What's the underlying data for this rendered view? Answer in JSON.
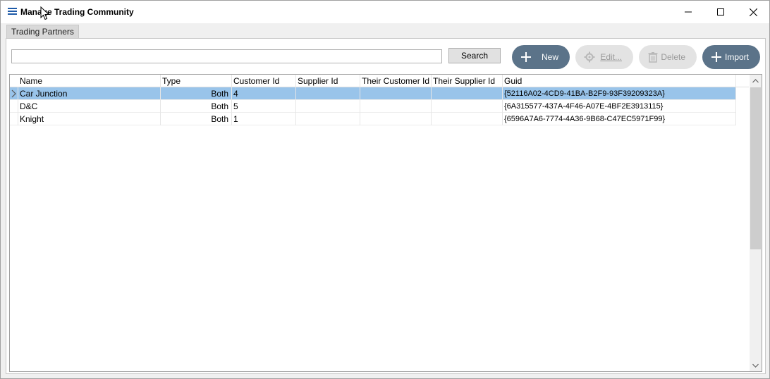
{
  "window": {
    "title": "Manage Trading Community",
    "controls": {
      "minimize_icon": "minimize-icon",
      "maximize_icon": "maximize-icon",
      "close_icon": "close-icon"
    }
  },
  "tabs": [
    {
      "label": "Trading Partners",
      "active": true
    }
  ],
  "search": {
    "value": "",
    "placeholder": "",
    "button_label": "Search"
  },
  "toolbar": {
    "new_label": "New",
    "edit_label": "Edit...",
    "delete_label": "Delete",
    "import_label": "Import"
  },
  "grid": {
    "columns": [
      "Name",
      "Type",
      "Customer Id",
      "Supplier Id",
      "Their Customer Id",
      "Their Supplier Id",
      "Guid"
    ],
    "rows": [
      {
        "name": "Car Junction",
        "type": "Both",
        "customer_id": "4",
        "supplier_id": "",
        "their_customer_id": "",
        "their_supplier_id": "",
        "guid": "{52116A02-4CD9-41BA-B2F9-93F39209323A}",
        "selected": true
      },
      {
        "name": "D&C",
        "type": "Both",
        "customer_id": "5",
        "supplier_id": "",
        "their_customer_id": "",
        "their_supplier_id": "",
        "guid": "{6A315577-437A-4F46-A07E-4BF2E3913115}",
        "selected": false
      },
      {
        "name": "Knight",
        "type": "Both",
        "customer_id": "1",
        "supplier_id": "",
        "their_customer_id": "",
        "their_supplier_id": "",
        "guid": "{6596A7A6-7774-4A36-9B68-C47EC5971F99}",
        "selected": false
      }
    ]
  },
  "colors": {
    "accent_button": "#5b7389",
    "selected_row": "#99c4ea",
    "title_icon": "#1e5aa8"
  }
}
